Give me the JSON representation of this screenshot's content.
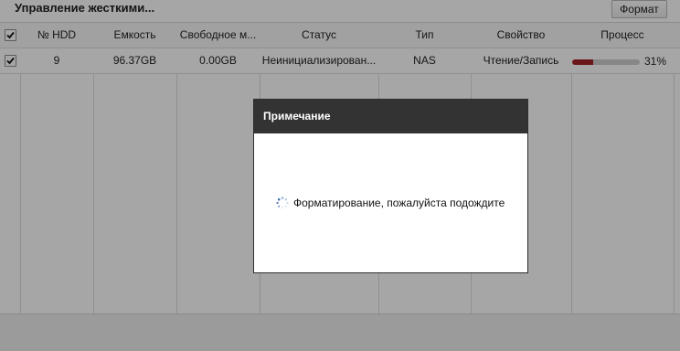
{
  "header": {
    "title": "Управление жесткими...",
    "format_button": "Формат"
  },
  "table": {
    "columns": [
      "№ HDD",
      "Емкость",
      "Свободное м...",
      "Статус",
      "Тип",
      "Свойство",
      "Процесс"
    ],
    "rows": [
      {
        "checked": true,
        "hdd_no": "9",
        "capacity": "96.37GB",
        "free": "0.00GB",
        "status": "Неинициализирован...",
        "type": "NAS",
        "property": "Чтение/Запись",
        "progress_percent": 31,
        "progress_label": "31%"
      }
    ],
    "header_checked": true,
    "progress_color": "#a3242a"
  },
  "dialog": {
    "title": "Примечание",
    "message": "Форматирование, пожалуйста подождите",
    "spinner_icon": "loading-spinner-icon"
  }
}
